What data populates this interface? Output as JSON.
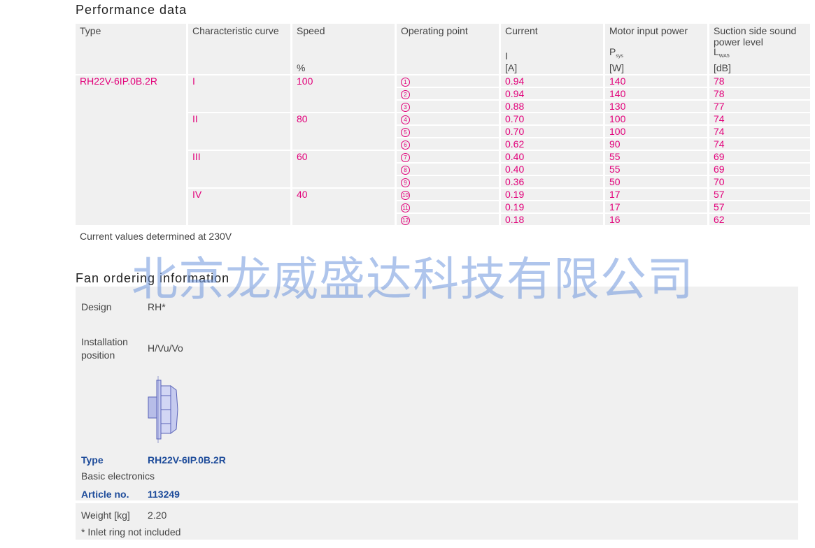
{
  "performance": {
    "title": "Performance data",
    "headers": {
      "type": "Type",
      "curve": "Characteristic curve",
      "speed": "Speed",
      "speed_unit": "%",
      "op": "Operating point",
      "current": "Current",
      "current_sym": "I",
      "current_unit": "[A]",
      "power": "Motor input power",
      "power_sym": "P",
      "power_sub": "sys",
      "power_unit": "[W]",
      "sound": "Suction side sound power level",
      "sound_sym": "L",
      "sound_sub": "WA5",
      "sound_unit": "[dB]"
    },
    "type_value": "RH22V-6IP.0B.2R",
    "groups": [
      {
        "curve": "I",
        "speed": "100",
        "rows": [
          {
            "op": "1",
            "current": "0.94",
            "power": "140",
            "sound": "78"
          },
          {
            "op": "2",
            "current": "0.94",
            "power": "140",
            "sound": "78"
          },
          {
            "op": "3",
            "current": "0.88",
            "power": "130",
            "sound": "77"
          }
        ]
      },
      {
        "curve": "II",
        "speed": "80",
        "rows": [
          {
            "op": "4",
            "current": "0.70",
            "power": "100",
            "sound": "74"
          },
          {
            "op": "5",
            "current": "0.70",
            "power": "100",
            "sound": "74"
          },
          {
            "op": "6",
            "current": "0.62",
            "power": "90",
            "sound": "74"
          }
        ]
      },
      {
        "curve": "III",
        "speed": "60",
        "rows": [
          {
            "op": "7",
            "current": "0.40",
            "power": "55",
            "sound": "69"
          },
          {
            "op": "8",
            "current": "0.40",
            "power": "55",
            "sound": "69"
          },
          {
            "op": "9",
            "current": "0.36",
            "power": "50",
            "sound": "70"
          }
        ]
      },
      {
        "curve": "IV",
        "speed": "40",
        "rows": [
          {
            "op": "10",
            "current": "0.19",
            "power": "17",
            "sound": "57"
          },
          {
            "op": "11",
            "current": "0.19",
            "power": "17",
            "sound": "57"
          },
          {
            "op": "12",
            "current": "0.18",
            "power": "16",
            "sound": "62"
          }
        ]
      }
    ],
    "note": "Current values determined at 230V"
  },
  "ordering": {
    "title": "Fan ordering information",
    "design_label": "Design",
    "design_value": "RH*",
    "install_label_1": "Installation",
    "install_label_2": "position",
    "install_value": "H/Vu/Vo",
    "type_label": "Type",
    "type_value": "RH22V-6IP.0B.2R",
    "electronics": "Basic electronics",
    "article_label": "Article no.",
    "article_value": "113249",
    "weight_label": "Weight [kg]",
    "weight_value": "2.20",
    "inlet_note": "* Inlet ring not included"
  },
  "watermark": "北京龙威盛达科技有限公司",
  "colors": {
    "accent": "#e2007a",
    "blue": "#1d4b9a",
    "panel": "#f0f0f0"
  }
}
